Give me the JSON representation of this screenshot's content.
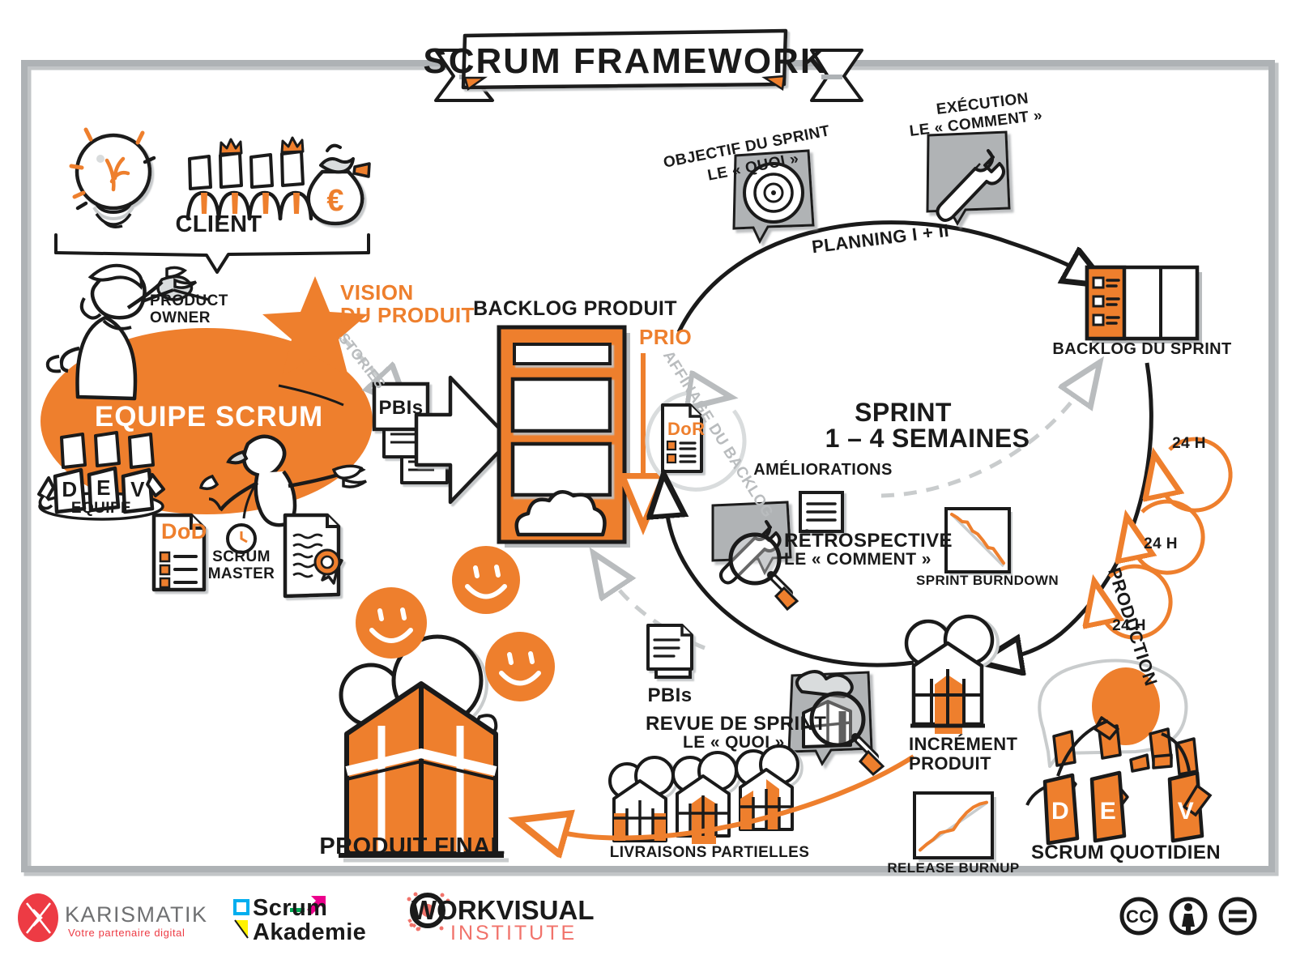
{
  "meta": {
    "title": "SCRUM FRAMEWORK",
    "language": "fr",
    "colors": {
      "orange": "#EE7F2D",
      "orange_dark": "#E0701C",
      "ink": "#1a1a1a",
      "gray_frame": "#AEB2B5",
      "gray_icon": "#B0B3B5",
      "gray_light": "#c9cccd",
      "white": "#ffffff",
      "karismatik_red": "#ED3B44",
      "scrum_cyan": "#00AEEF",
      "scrum_magenta": "#EC008C",
      "scrum_yellow": "#FFF200",
      "scrum_green": "#00A651",
      "workvisual_salmon": "#F1736B"
    }
  },
  "banner": {
    "title": "SCRUM FRAMEWORK"
  },
  "client_zone": {
    "label": "CLIENT",
    "icons": [
      {
        "name": "lightbulb-idea-icon",
        "meaning": "idea"
      },
      {
        "name": "stakeholders-crowns-icon",
        "meaning": "customers with crowns"
      },
      {
        "name": "money-bag-euro-icon",
        "meaning": "budget",
        "symbol": "€"
      }
    ]
  },
  "team_zone": {
    "ellipse_label": "EQUIPE SCRUM",
    "product_owner_label": "PRODUCT\nOWNER",
    "scrum_master_label": "SCRUM\nMASTER",
    "dev_team_label": "EQUIPE",
    "dev_letters": [
      "D",
      "E",
      "V"
    ],
    "dod_label": "DoD",
    "vision_label": "VISION\nDU PRODUIT",
    "stories_label": "STORIES",
    "pbis_label": "PBIs"
  },
  "backlog_produit": {
    "title": "BACKLOG PRODUIT",
    "prio_label": "PRIO",
    "refinement_label": "AFFINAGE DU BACKLOG",
    "dor_label": "DoR"
  },
  "planning": {
    "curve_label": "PLANNING I + II",
    "sprint_goal": {
      "title": "OBJECTIF DU SPRINT",
      "subtitle": "LE « QUOI »",
      "icon": "target-bullseye-icon"
    },
    "execution": {
      "title": "EXÉCUTION",
      "subtitle": "LE « COMMENT »",
      "icon": "wrench-icon"
    }
  },
  "sprint_backlog": {
    "label": "BACKLOG DU SPRINT"
  },
  "sprint": {
    "title": "SPRINT",
    "duration": "1 – 4 SEMAINES",
    "production_label": "PRODUCTION",
    "daily_cycles": [
      "24 H",
      "24 H",
      "24 H"
    ]
  },
  "retrospective": {
    "improvements_label": "AMÉLIORATIONS",
    "title": "RÉTROSPECTIVE",
    "subtitle": "LE « COMMENT »",
    "icon": "wrench-magnifier-icon"
  },
  "sprint_review": {
    "pbis_label": "PBIs",
    "title": "REVUE DE SPRINT",
    "subtitle": "LE « QUOI »",
    "icon": "increment-magnifier-icon"
  },
  "increment": {
    "label": "INCRÉMENT\nPRODUIT"
  },
  "daily_scrum": {
    "label": "SCRUM QUOTIDIEN",
    "dev_letters": [
      "D",
      "E",
      "V"
    ]
  },
  "partial_deliveries": {
    "label": "LIVRAISONS PARTIELLES",
    "count": 3
  },
  "final_product": {
    "label": "PRODUIT FINAL",
    "smiley_count": 3
  },
  "charts": [
    {
      "name": "sprint-burndown",
      "label": "SPRINT BURNDOWN",
      "chart_data": {
        "type": "line",
        "title": "SPRINT BURNDOWN",
        "xlabel": "",
        "ylabel": "",
        "xlim": [
          0,
          10
        ],
        "ylim": [
          0,
          10
        ],
        "grid": false,
        "legend": "none",
        "series": [
          {
            "name": "ideal",
            "color": "#c9cccd",
            "x": [
              0,
              10
            ],
            "y": [
              10,
              0
            ]
          },
          {
            "name": "actual",
            "color": "#EE7F2D",
            "x": [
              0,
              1,
              2,
              3,
              4,
              5,
              6,
              7,
              8,
              9,
              10
            ],
            "y": [
              10,
              9.4,
              8.6,
              8.5,
              6.8,
              6.2,
              5.0,
              3.6,
              3.4,
              2.0,
              0.6
            ]
          }
        ]
      }
    },
    {
      "name": "release-burnup",
      "label": "RELEASE BURNUP",
      "chart_data": {
        "type": "line",
        "title": "RELEASE BURNUP",
        "xlabel": "",
        "ylabel": "",
        "xlim": [
          0,
          10
        ],
        "ylim": [
          0,
          10
        ],
        "grid": false,
        "legend": "none",
        "series": [
          {
            "name": "ideal",
            "color": "#c9cccd",
            "x": [
              0,
              10
            ],
            "y": [
              0.5,
              9.2
            ]
          },
          {
            "name": "actual",
            "color": "#EE7F2D",
            "x": [
              0,
              1,
              2,
              3,
              4,
              5,
              6,
              7,
              8,
              9,
              10
            ],
            "y": [
              0.4,
              1.5,
              2.4,
              3.6,
              3.9,
              4.2,
              6.0,
              7.4,
              8.4,
              9.0,
              9.3
            ]
          }
        ]
      }
    }
  ],
  "footer": {
    "logos": [
      {
        "name": "karismatik-logo",
        "title": "KARISMATIK",
        "tagline": "Votre partenaire digital",
        "mark": "⤴"
      },
      {
        "name": "scrum-akademie-logo",
        "line1": "Scrum",
        "line2": "Akademie"
      },
      {
        "name": "workvisual-logo",
        "line1": "WORKVISUAL",
        "line2": "INSTITUTE"
      }
    ],
    "license": {
      "name": "creative-commons-license",
      "badges": [
        "cc",
        "by",
        "nd"
      ],
      "glyphs": [
        "CC",
        "὆4",
        "="
      ]
    }
  }
}
